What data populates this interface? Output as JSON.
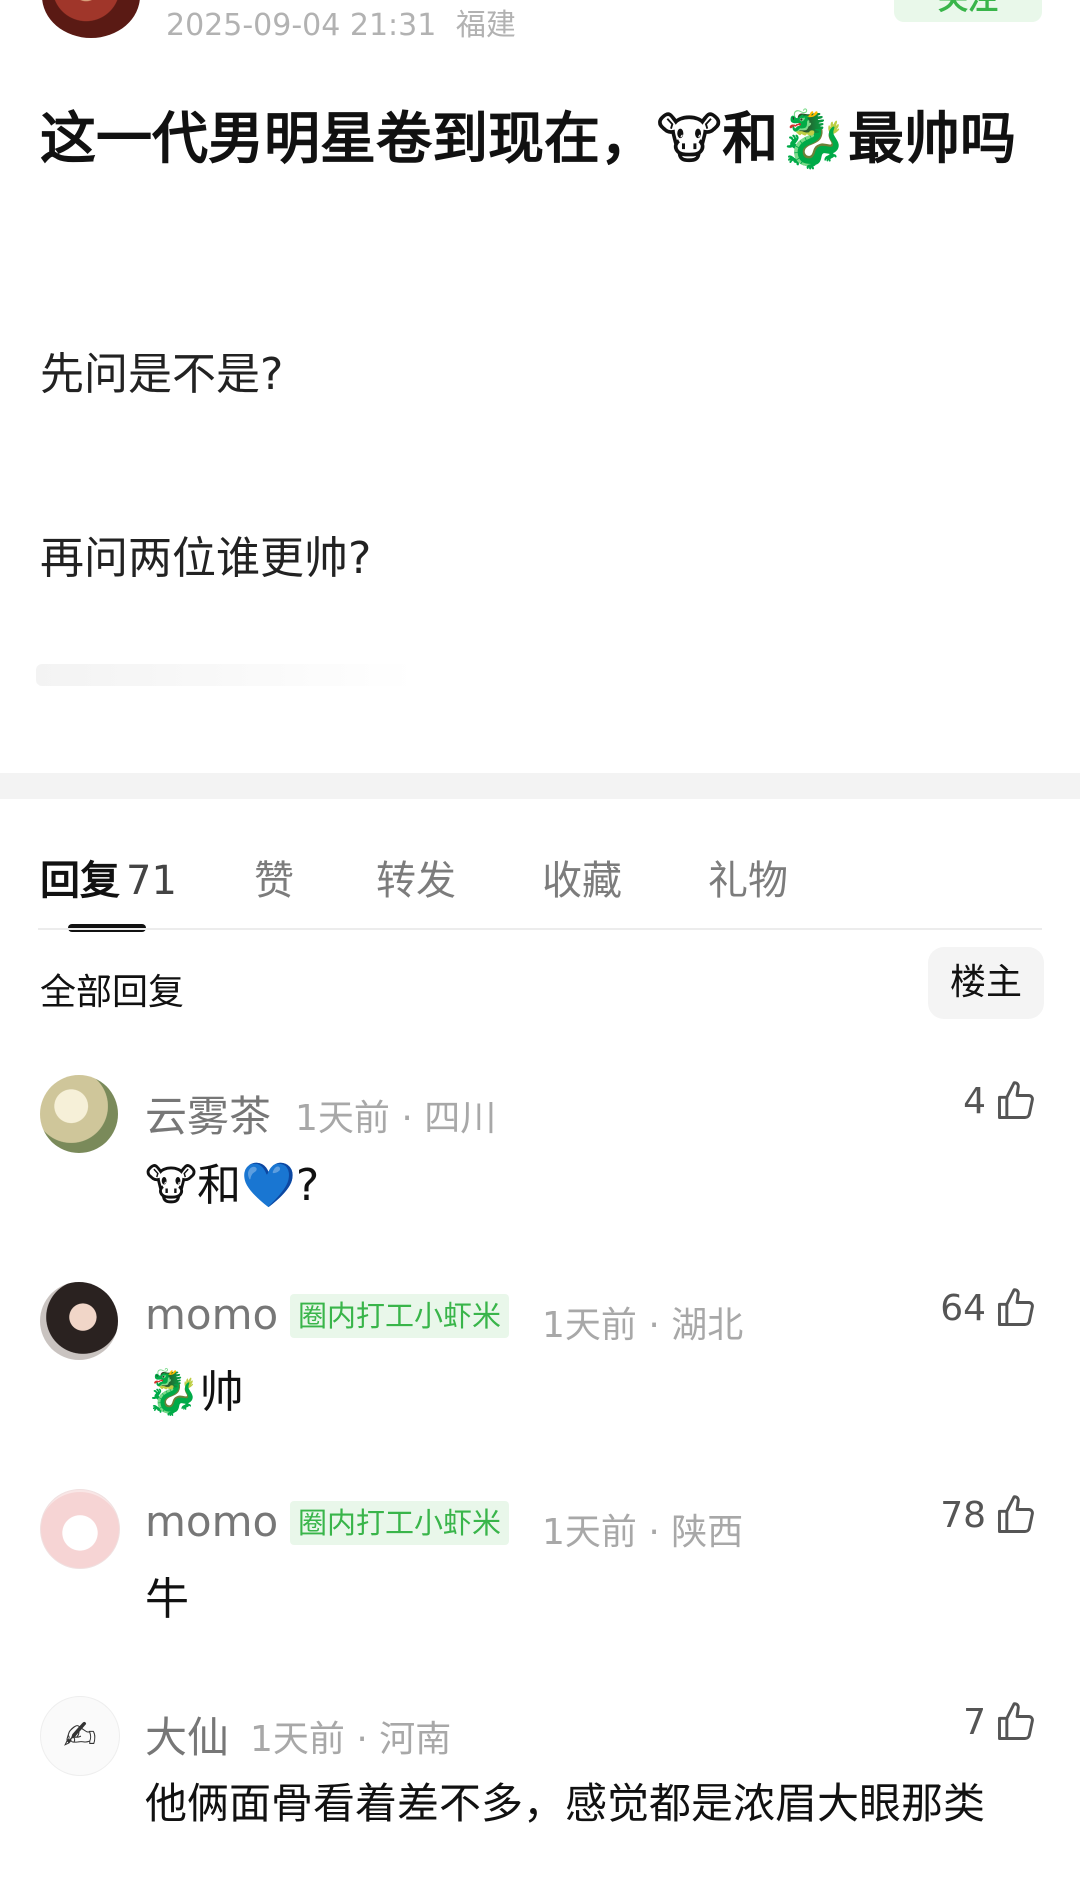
{
  "post": {
    "datetime": "2025-09-04 21:31",
    "location": "福建",
    "follow_label": "关注",
    "title": "这一代男明星卷到现在，🐮和🐉最帅吗",
    "body": [
      "先问是不是?",
      "再问两位谁更帅?"
    ]
  },
  "tabs": [
    {
      "label": "回复",
      "count": "71",
      "active": true
    },
    {
      "label": "赞"
    },
    {
      "label": "转发"
    },
    {
      "label": "收藏"
    },
    {
      "label": "礼物"
    }
  ],
  "replies_header": {
    "label": "全部回复",
    "owner_button": "楼主"
  },
  "comments": [
    {
      "name": "云雾茶",
      "time_loc": "1天前 · 四川",
      "likes": "4",
      "text": "🐮和💙?"
    },
    {
      "name": "momo",
      "badge": "圈内打工小虾米",
      "time_loc": "1天前 · 湖北",
      "likes": "64",
      "text": "🐉帅"
    },
    {
      "name": "momo",
      "badge": "圈内打工小虾米",
      "time_loc": "1天前 · 陕西",
      "likes": "78",
      "text": "牛"
    },
    {
      "name": "大仙",
      "time_loc": "1天前 · 河南",
      "likes": "7",
      "text": "他俩面骨看着差不多，感觉都是浓眉大眼那类"
    }
  ],
  "colors": {
    "accent_green": "#39b54a",
    "badge_bg": "#e9f7ea",
    "muted": "#a8a8a8"
  }
}
